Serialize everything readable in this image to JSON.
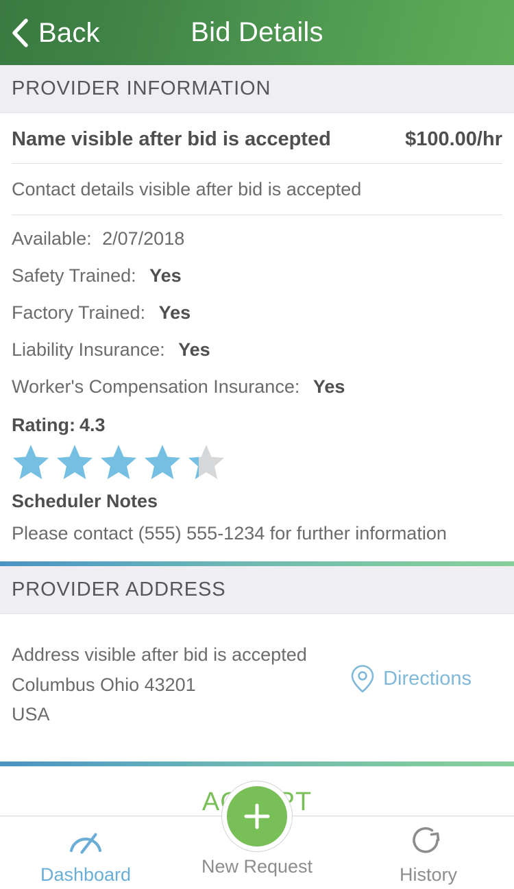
{
  "header": {
    "back_label": "Back",
    "title": "Bid Details",
    "back_icon": "chevron-left-icon",
    "gradient_from": "#3a7a42",
    "gradient_to": "#60ae59"
  },
  "provider_information": {
    "section_title": "PROVIDER INFORMATION",
    "name": "Name visible after bid is accepted",
    "rate": "$100.00/hr",
    "contact": "Contact details visible after bid is accepted",
    "attributes": [
      {
        "label": "Available:",
        "value": "2/07/2018",
        "bold_value": false
      },
      {
        "label": "Safety Trained:",
        "value": "Yes",
        "bold_value": true
      },
      {
        "label": "Factory Trained:",
        "value": "Yes",
        "bold_value": true
      },
      {
        "label": "Liability Insurance:",
        "value": "Yes",
        "bold_value": true
      },
      {
        "label": "Worker's Compensation Insurance:",
        "value": "Yes",
        "bold_value": true
      }
    ],
    "rating": {
      "label": "Rating:",
      "score": "4.3",
      "max": 5,
      "filled_color": "#74bfe2",
      "empty_color": "#d5d7d8"
    },
    "scheduler_notes": {
      "title": "Scheduler Notes",
      "body": "Please contact (555) 555-1234 for further information"
    }
  },
  "provider_address": {
    "section_title": "PROVIDER ADDRESS",
    "line1": "Address visible after bid is accepted",
    "line2": "Columbus  Ohio 43201",
    "line3": "USA",
    "directions_label": "Directions",
    "directions_icon": "map-pin-icon",
    "directions_color": "#7fb8d8"
  },
  "accept": {
    "label": "ACCEPT",
    "color": "#79bf58"
  },
  "tabbar": {
    "items": [
      {
        "label": "Dashboard",
        "icon": "speedometer-icon",
        "active": true
      },
      {
        "label": "New Request",
        "icon": "plus-icon",
        "active": false
      },
      {
        "label": "History",
        "icon": "refresh-circle-icon",
        "active": false
      }
    ],
    "fab_color": "#79bf58",
    "active_color": "#6aadd6",
    "inactive_color": "#8d8d8d"
  },
  "dividers": {
    "gradient_from": "#4a93c3",
    "gradient_to": "#86cf9a"
  }
}
